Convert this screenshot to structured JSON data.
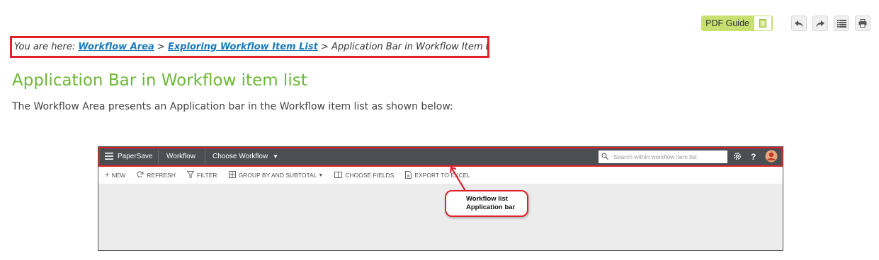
{
  "top_toolbar": {
    "pdf_label": "PDF Guide",
    "icons": [
      "pdf-icon",
      "back-icon",
      "forward-icon",
      "toc-icon",
      "print-icon"
    ]
  },
  "breadcrumb": {
    "prefix": "You are here:",
    "links": [
      "Workflow Area",
      "Exploring Workflow Item List"
    ],
    "separator": ">",
    "current": "Application Bar in Workflow Item List"
  },
  "page": {
    "title": "Application Bar in Workflow item list",
    "intro": "The Workflow Area presents an Application bar in the Workflow item list as shown below:"
  },
  "screenshot": {
    "app_name": "PaperSave",
    "module": "Workflow",
    "choose_workflow": "Choose Workflow",
    "search_placeholder": "Search within workflow item list",
    "actions": [
      "NEW",
      "REFRESH",
      "FILTER",
      "GROUP BY AND SUBTOTAL",
      "CHOOSE FIELDS",
      "EXPORT TO EXCEL"
    ],
    "callout_line1": "Workflow list",
    "callout_line2": "Application bar"
  },
  "colors": {
    "title_green": "#6cb836",
    "link_blue": "#1a7bbd",
    "highlight_red": "#e0202a",
    "appbar_dark": "#4b4e53",
    "pdf_button": "#c7e070"
  }
}
